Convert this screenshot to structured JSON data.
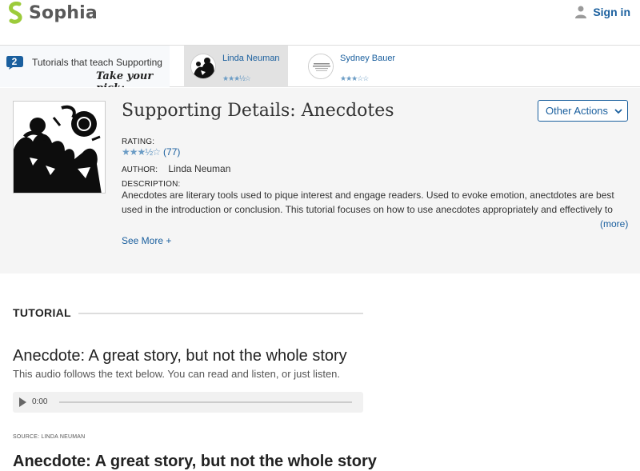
{
  "header": {
    "logo_text": "Sophia",
    "signin_label": "Sign in"
  },
  "tutorials_bar": {
    "count": "2",
    "title": "Tutorials that teach Supporting Details: Anecdotes",
    "pick_label": "Take your pick:",
    "cards": [
      {
        "author": "Linda Neuman",
        "rating_stars": "★★★½☆"
      },
      {
        "author": "Sydney Bauer",
        "rating_stars": "★★★☆☆"
      }
    ]
  },
  "tutorial": {
    "title": "Supporting Details: Anecdotes",
    "other_actions_label": "Other Actions",
    "rating_label": "RATING:",
    "rating_stars": "★★★½☆",
    "rating_count": "(77)",
    "author_label": "AUTHOR:",
    "author": "Linda Neuman",
    "description_label": "DESCRIPTION:",
    "description": "Anecdotes are literary tools used to pique interest and engage readers. Used to evoke emotion, anectdotes are best used in the introduction or conclusion. This tutorial focuses on how to use anecdotes appropriately and effectively to make your",
    "more_label": "(more)",
    "see_more_label": "See More +"
  },
  "content": {
    "section_label": "TUTORIAL",
    "heading": "Anecdote: A great story, but not the whole story",
    "subheading": "This audio follows the text below. You can read and listen, or just listen.",
    "audio_time": "0:00",
    "source": "SOURCE: LINDA NEUMAN",
    "next_heading": "Anecdote: A great story, but not the whole story"
  },
  "colors": {
    "link": "#1a5f9e",
    "logo_green": "#9ccb3b",
    "stars": "#6b9cc5"
  }
}
